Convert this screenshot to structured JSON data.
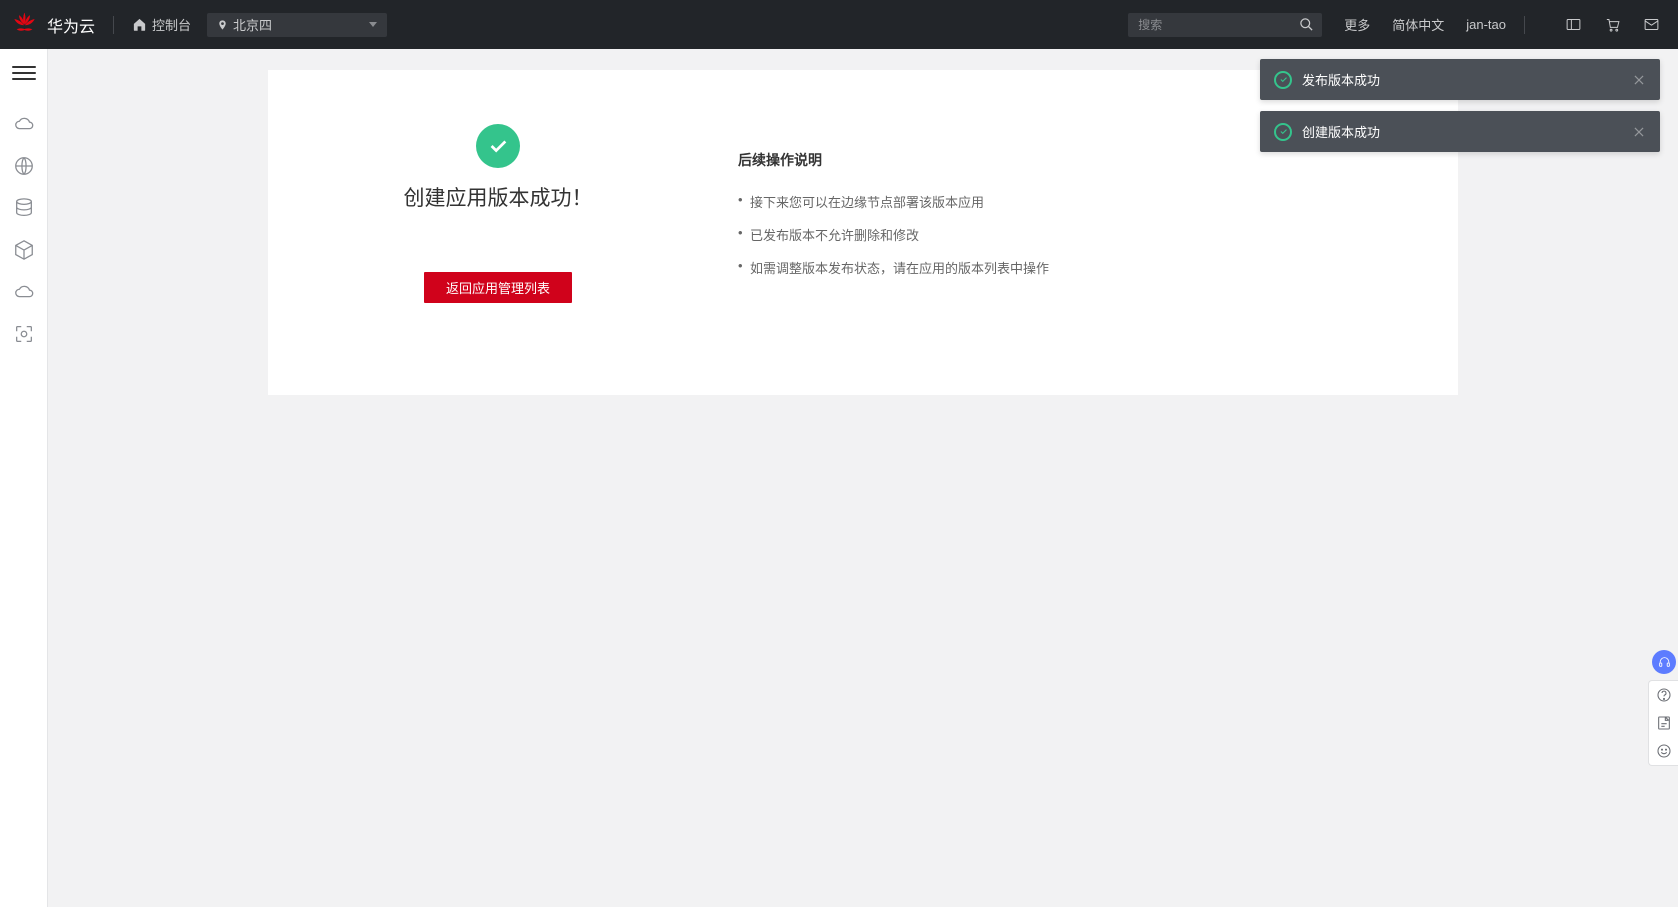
{
  "header": {
    "brand": "华为云",
    "console": "控制台",
    "region": "北京四",
    "searchPlaceholder": "搜索",
    "more": "更多",
    "lang": "简体中文",
    "user": "jan-tao"
  },
  "main": {
    "successTitle": "创建应用版本成功！",
    "backButton": "返回应用管理列表",
    "instructionsTitle": "后续操作说明",
    "instructions": [
      "接下来您可以在边缘节点部署该版本应用",
      "已发布版本不允许删除和修改",
      "如需调整版本发布状态，请在应用的版本列表中操作"
    ]
  },
  "toasts": [
    {
      "text": "发布版本成功"
    },
    {
      "text": "创建版本成功"
    }
  ]
}
